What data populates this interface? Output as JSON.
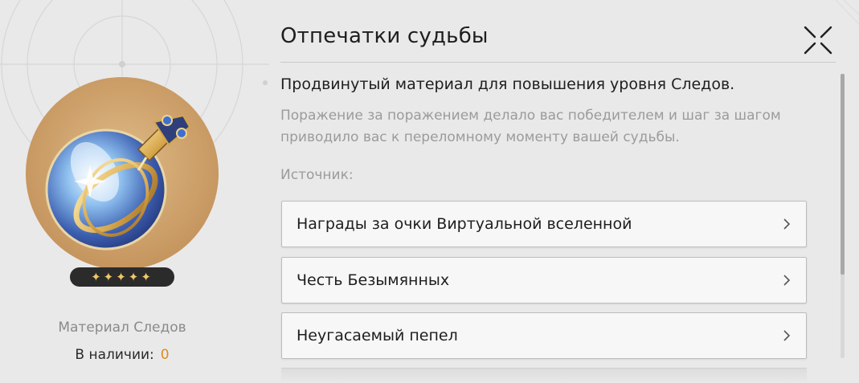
{
  "item": {
    "title": "Отпечатки судьбы",
    "stars": "✦✦✦✦✦",
    "rarity_stars": 5,
    "type": "Материал Следов",
    "stock_label": "В наличии:",
    "stock_count": "0"
  },
  "details": {
    "description": "Продвинутый материал для повышения уровня Следов.",
    "flavor": "Поражение за поражением делало вас победителем и шаг за шагом приводило вас к переломному моменту вашей судьбы.",
    "source_label": "Источник:",
    "sources": [
      {
        "label": "Награды за очки Виртуальной вселенной"
      },
      {
        "label": "Честь Безымянных"
      },
      {
        "label": "Неугасаемый пепел"
      }
    ]
  },
  "icons": {
    "close": "close-icon",
    "chevron": "chevron-right-icon"
  },
  "colors": {
    "accent_count": "#e08a1e",
    "star": "#f0c766",
    "badge": "#2b2b2b"
  }
}
